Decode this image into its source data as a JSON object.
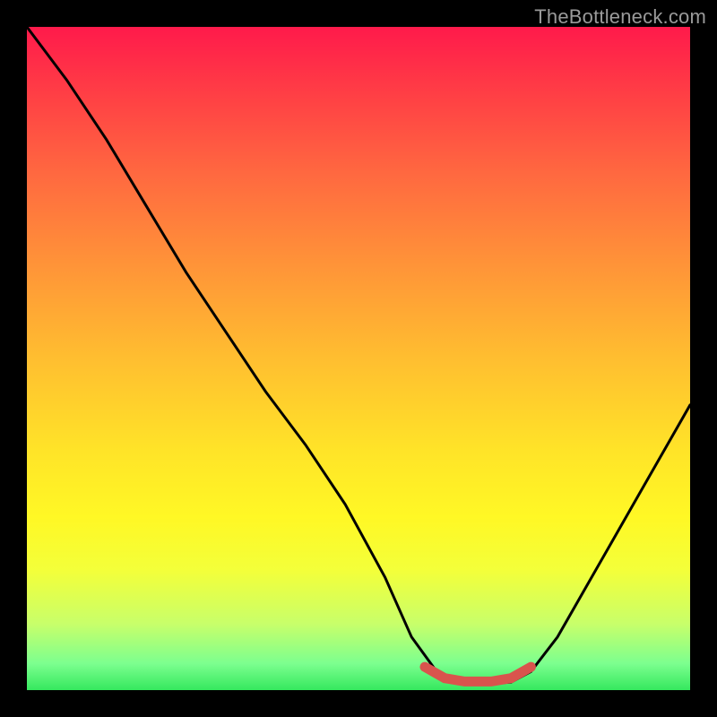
{
  "watermark": "TheBottleneck.com",
  "chart_data": {
    "type": "line",
    "title": "",
    "xlabel": "",
    "ylabel": "",
    "xlim": [
      0,
      100
    ],
    "ylim": [
      0,
      100
    ],
    "series": [
      {
        "name": "bottleneck-curve",
        "color": "#000000",
        "x": [
          0,
          6,
          12,
          18,
          24,
          30,
          36,
          42,
          48,
          54,
          58,
          62,
          64,
          66,
          70,
          73,
          76,
          80,
          84,
          88,
          92,
          96,
          100
        ],
        "y": [
          100,
          92,
          83,
          73,
          63,
          54,
          45,
          37,
          28,
          17,
          8,
          2.5,
          1.2,
          1.0,
          1.0,
          1.2,
          2.8,
          8,
          15,
          22,
          29,
          36,
          43
        ]
      },
      {
        "name": "optimal-band",
        "color": "#d9544d",
        "x": [
          60,
          63,
          66,
          70,
          73,
          76
        ],
        "y": [
          3.5,
          1.8,
          1.3,
          1.3,
          1.8,
          3.5
        ]
      }
    ],
    "background_gradient": {
      "top": "#ff1a4b",
      "mid": "#ffe428",
      "bottom": "#35e85e"
    }
  }
}
